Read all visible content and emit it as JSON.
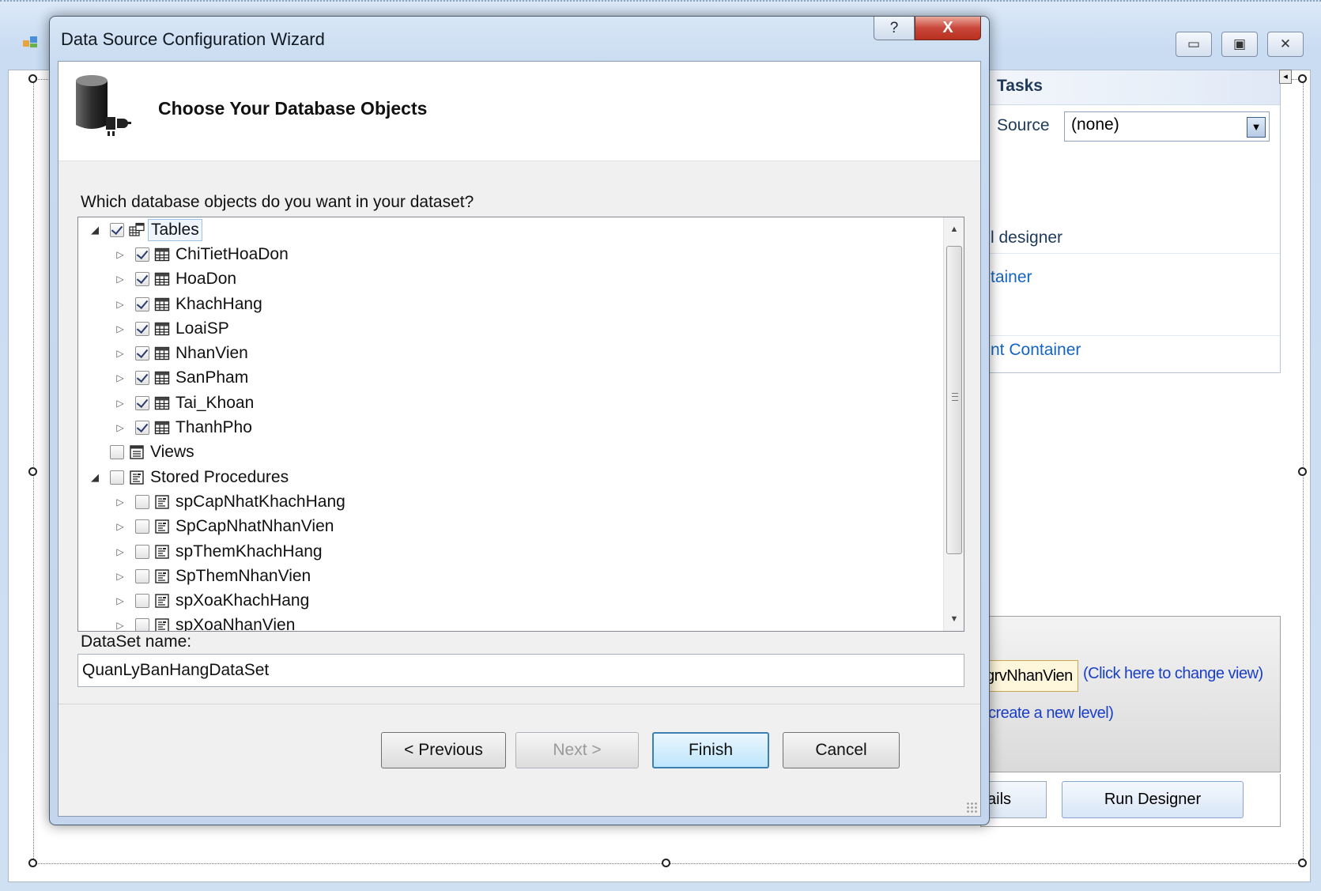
{
  "wizard": {
    "title": "Data Source Configuration Wizard",
    "help_glyph": "?",
    "close_glyph": "X",
    "header_title": "Choose Your Database Objects",
    "question": "Which database objects do you want in your dataset?",
    "tree": [
      {
        "label": "Tables",
        "level": 0,
        "expander": "expanded",
        "checked": true,
        "icon": "tables-folder-icon",
        "selected": true
      },
      {
        "label": "ChiTietHoaDon",
        "level": 1,
        "expander": "collapsed",
        "checked": true,
        "icon": "table-icon"
      },
      {
        "label": "HoaDon",
        "level": 1,
        "expander": "collapsed",
        "checked": true,
        "icon": "table-icon"
      },
      {
        "label": "KhachHang",
        "level": 1,
        "expander": "collapsed",
        "checked": true,
        "icon": "table-icon"
      },
      {
        "label": "LoaiSP",
        "level": 1,
        "expander": "collapsed",
        "checked": true,
        "icon": "table-icon"
      },
      {
        "label": "NhanVien",
        "level": 1,
        "expander": "collapsed",
        "checked": true,
        "icon": "table-icon"
      },
      {
        "label": "SanPham",
        "level": 1,
        "expander": "collapsed",
        "checked": true,
        "icon": "table-icon"
      },
      {
        "label": "Tai_Khoan",
        "level": 1,
        "expander": "collapsed",
        "checked": true,
        "icon": "table-icon"
      },
      {
        "label": "ThanhPho",
        "level": 1,
        "expander": "collapsed",
        "checked": true,
        "icon": "table-icon"
      },
      {
        "label": "Views",
        "level": 0,
        "expander": "none",
        "checked": false,
        "icon": "view-icon"
      },
      {
        "label": "Stored Procedures",
        "level": 0,
        "expander": "expanded",
        "checked": false,
        "icon": "stored-procedure-icon"
      },
      {
        "label": "spCapNhatKhachHang",
        "level": 1,
        "expander": "collapsed",
        "checked": false,
        "icon": "stored-procedure-icon"
      },
      {
        "label": "SpCapNhatNhanVien",
        "level": 1,
        "expander": "collapsed",
        "checked": false,
        "icon": "stored-procedure-icon"
      },
      {
        "label": "spThemKhachHang",
        "level": 1,
        "expander": "collapsed",
        "checked": false,
        "icon": "stored-procedure-icon"
      },
      {
        "label": "SpThemNhanVien",
        "level": 1,
        "expander": "collapsed",
        "checked": false,
        "icon": "stored-procedure-icon"
      },
      {
        "label": "spXoaKhachHang",
        "level": 1,
        "expander": "collapsed",
        "checked": false,
        "icon": "stored-procedure-icon"
      },
      {
        "label": "spXoaNhanVien",
        "level": 1,
        "expander": "collapsed",
        "checked": false,
        "icon": "stored-procedure-icon"
      }
    ],
    "dataset_label": "DataSet name:",
    "dataset_value": "QuanLyBanHangDataSet",
    "buttons": {
      "previous": "< Previous",
      "next": "Next >",
      "finish": "Finish",
      "cancel": "Cancel"
    }
  },
  "background": {
    "tasks_title": "Tasks",
    "source_label": "Source",
    "source_value": "(none)",
    "designer_text": "l designer",
    "container_link": "tainer",
    "container_link2": "nt Container",
    "grv_label": "grvNhanVien",
    "change_view_link": "(Click here to change view)",
    "new_level_link": "create a new level)",
    "details_button": "ails",
    "run_designer_button": "Run Designer",
    "window_controls": {
      "minimize": "▭",
      "restore": "▣",
      "close": "✕"
    }
  },
  "colors": {
    "link": "#1565c0",
    "title_text": "#1e395b",
    "close_red": "#c9463a",
    "default_button_border": "#3c7fb1"
  }
}
